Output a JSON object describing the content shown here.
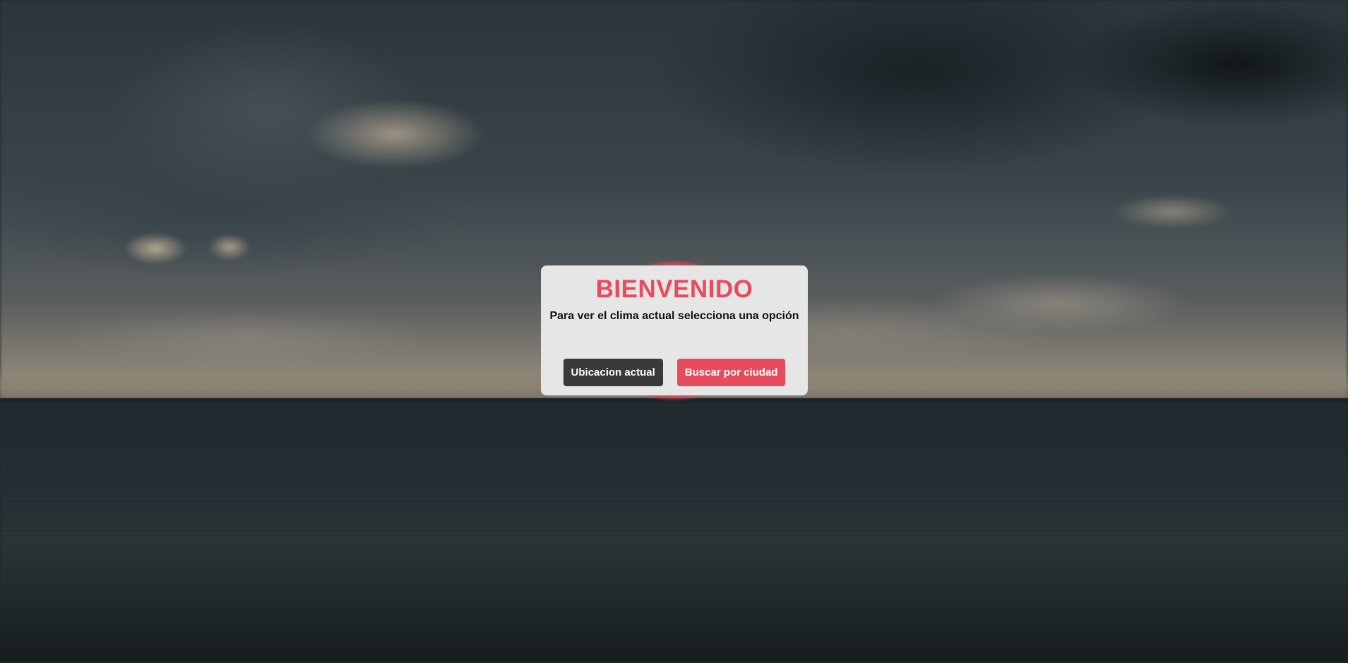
{
  "background": {
    "scene": "stormy-sky-over-sea",
    "accent_color": "#e84c5c"
  },
  "welcome_modal": {
    "title": "BIENVENIDO",
    "subtitle": "Para ver el clima actual selecciona una opción",
    "buttons": {
      "current_location_label": "Ubicacion actual",
      "search_city_label": "Buscar por ciudad"
    }
  },
  "colors": {
    "title": "#e84c5c",
    "modal_background": "#e6e6e6",
    "location_button": "#3a3a3a",
    "search_button": "#e84c5c"
  }
}
